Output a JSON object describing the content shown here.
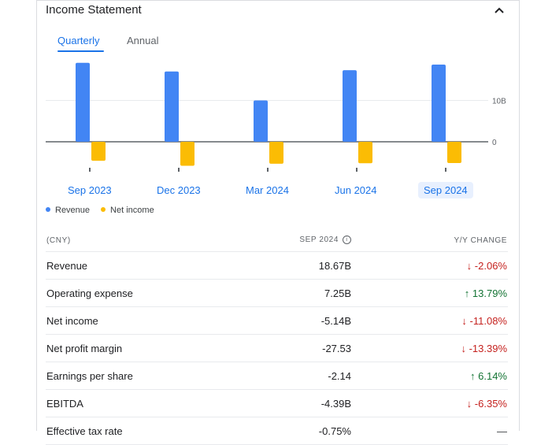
{
  "header": {
    "title": "Income Statement",
    "collapse_icon": "chevron-up-icon"
  },
  "tabs": [
    {
      "label": "Quarterly",
      "active": true
    },
    {
      "label": "Annual",
      "active": false
    }
  ],
  "chart_data": {
    "type": "bar",
    "categories": [
      "Sep 2023",
      "Dec 2023",
      "Mar 2024",
      "Jun 2024",
      "Sep 2024"
    ],
    "selected_category": "Sep 2024",
    "series": [
      {
        "name": "Revenue",
        "color": "#4285f4",
        "values": [
          19.1,
          17.0,
          10.0,
          17.3,
          18.67
        ]
      },
      {
        "name": "Net income",
        "color": "#fbbc04",
        "values": [
          -4.6,
          -5.8,
          -5.3,
          -5.2,
          -5.14
        ]
      }
    ],
    "y_ticks": [
      {
        "value": 10,
        "label": "10B"
      },
      {
        "value": 0,
        "label": "0"
      }
    ],
    "ylim": [
      -6,
      20
    ],
    "legend_position": "bottom-left"
  },
  "legend": [
    {
      "label": "Revenue",
      "color": "#4285f4"
    },
    {
      "label": "Net income",
      "color": "#fbbc04"
    }
  ],
  "table": {
    "headers": {
      "currency": "(CNY)",
      "period": "SEP 2024",
      "change": "Y/Y CHANGE"
    },
    "rows": [
      {
        "label": "Revenue",
        "value": "18.67B",
        "change": "-2.06%",
        "direction": "down"
      },
      {
        "label": "Operating expense",
        "value": "7.25B",
        "change": "13.79%",
        "direction": "up"
      },
      {
        "label": "Net income",
        "value": "-5.14B",
        "change": "-11.08%",
        "direction": "down"
      },
      {
        "label": "Net profit margin",
        "value": "-27.53",
        "change": "-13.39%",
        "direction": "down"
      },
      {
        "label": "Earnings per share",
        "value": "-2.14",
        "change": "6.14%",
        "direction": "up"
      },
      {
        "label": "EBITDA",
        "value": "-4.39B",
        "change": "-6.35%",
        "direction": "down"
      },
      {
        "label": "Effective tax rate",
        "value": "-0.75%",
        "change": "—",
        "direction": "flat"
      }
    ]
  }
}
